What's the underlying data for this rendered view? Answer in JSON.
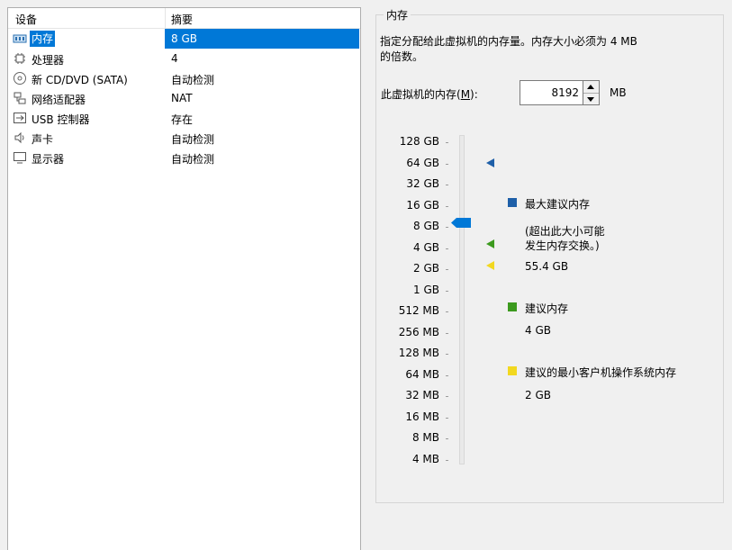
{
  "device_list": {
    "headers": {
      "device": "设备",
      "summary": "摘要"
    },
    "rows": [
      {
        "name": "内存",
        "summary": "8 GB",
        "icon": "memory-icon",
        "selected": true
      },
      {
        "name": "处理器",
        "summary": "4",
        "icon": "processor-icon"
      },
      {
        "name": "新 CD/DVD (SATA)",
        "summary": "自动检测",
        "icon": "cd-dvd-icon"
      },
      {
        "name": "网络适配器",
        "summary": "NAT",
        "icon": "network-adapter-icon"
      },
      {
        "name": "USB 控制器",
        "summary": "存在",
        "icon": "usb-controller-icon"
      },
      {
        "name": "声卡",
        "summary": "自动检测",
        "icon": "sound-card-icon"
      },
      {
        "name": "显示器",
        "summary": "自动检测",
        "icon": "display-icon"
      }
    ]
  },
  "memory": {
    "group_title": "内存",
    "description_line1": "指定分配给此虚拟机的内存量。内存大小必须为 4 MB",
    "description_line2": "的倍数。",
    "label_prefix": "此虚拟机的内存(",
    "label_accel": "M",
    "label_suffix": "):",
    "value": "8192",
    "unit": "MB",
    "scale_labels": [
      "128 GB",
      "64 GB",
      "32 GB",
      "16 GB",
      "8 GB",
      "4 GB",
      "2 GB",
      "1 GB",
      "512 MB",
      "256 MB",
      "128 MB",
      "64 MB",
      "32 MB",
      "16 MB",
      "8 MB",
      "4 MB"
    ],
    "legend": {
      "max_title": "最大建议内存",
      "max_note_line1": "(超出此大小可能",
      "max_note_line2": "发生内存交换。)",
      "max_value": "55.4 GB",
      "rec_title": "建议内存",
      "rec_value": "4 GB",
      "min_title": "建议的最小客户机操作系统内存",
      "min_value": "2 GB"
    },
    "colors": {
      "max": "#1e5fa8",
      "recommended": "#3c9a1e",
      "minimum": "#f2d820",
      "thumb": "#0078d7",
      "selection": "#0078d7"
    }
  }
}
